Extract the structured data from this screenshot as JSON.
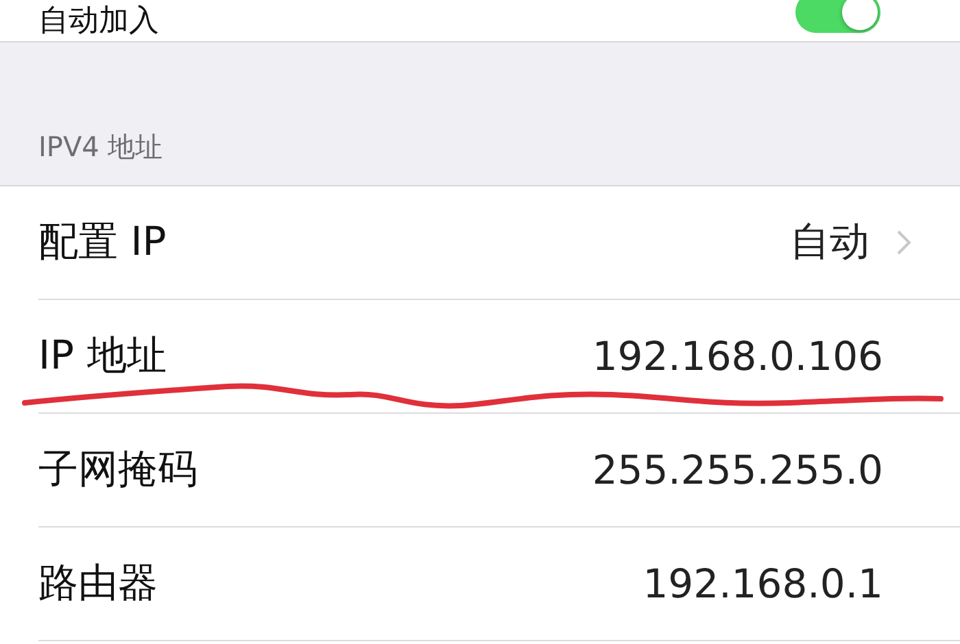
{
  "auto_join": {
    "label": "自动加入",
    "on": true
  },
  "section_header": "IPV4 地址",
  "rows": [
    {
      "label": "配置 IP",
      "value": "自动",
      "kind": "link"
    },
    {
      "label": "IP 地址",
      "value": "192.168.0.106",
      "kind": "info"
    },
    {
      "label": "子网掩码",
      "value": "255.255.255.0",
      "kind": "info"
    },
    {
      "label": "路由器",
      "value": "192.168.0.1",
      "kind": "info"
    }
  ]
}
